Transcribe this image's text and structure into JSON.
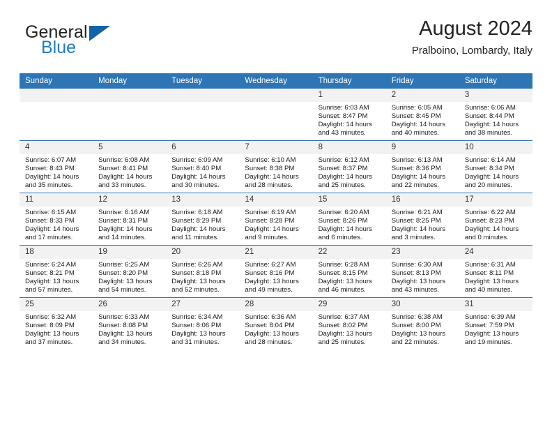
{
  "brand": {
    "word_one": "General",
    "word_two": "Blue",
    "logo_icon": "triangle-logo-icon",
    "accent_color": "#1463a8",
    "blue_text_color": "#1f7bc1"
  },
  "header": {
    "title": "August 2024",
    "subtitle": "Pralboino, Lombardy, Italy"
  },
  "theme": {
    "header_row_color": "#2e75b6",
    "daynum_band_color": "#f2f2f2",
    "text_color": "#1a1a1a"
  },
  "weekdays": [
    "Sunday",
    "Monday",
    "Tuesday",
    "Wednesday",
    "Thursday",
    "Friday",
    "Saturday"
  ],
  "weeks": [
    [
      {
        "day": "",
        "empty": true
      },
      {
        "day": "",
        "empty": true
      },
      {
        "day": "",
        "empty": true
      },
      {
        "day": "",
        "empty": true
      },
      {
        "day": "1",
        "sunrise": "Sunrise: 6:03 AM",
        "sunset": "Sunset: 8:47 PM",
        "daylight": "Daylight: 14 hours and 43 minutes."
      },
      {
        "day": "2",
        "sunrise": "Sunrise: 6:05 AM",
        "sunset": "Sunset: 8:45 PM",
        "daylight": "Daylight: 14 hours and 40 minutes."
      },
      {
        "day": "3",
        "sunrise": "Sunrise: 6:06 AM",
        "sunset": "Sunset: 8:44 PM",
        "daylight": "Daylight: 14 hours and 38 minutes."
      }
    ],
    [
      {
        "day": "4",
        "sunrise": "Sunrise: 6:07 AM",
        "sunset": "Sunset: 8:43 PM",
        "daylight": "Daylight: 14 hours and 35 minutes."
      },
      {
        "day": "5",
        "sunrise": "Sunrise: 6:08 AM",
        "sunset": "Sunset: 8:41 PM",
        "daylight": "Daylight: 14 hours and 33 minutes."
      },
      {
        "day": "6",
        "sunrise": "Sunrise: 6:09 AM",
        "sunset": "Sunset: 8:40 PM",
        "daylight": "Daylight: 14 hours and 30 minutes."
      },
      {
        "day": "7",
        "sunrise": "Sunrise: 6:10 AM",
        "sunset": "Sunset: 8:38 PM",
        "daylight": "Daylight: 14 hours and 28 minutes."
      },
      {
        "day": "8",
        "sunrise": "Sunrise: 6:12 AM",
        "sunset": "Sunset: 8:37 PM",
        "daylight": "Daylight: 14 hours and 25 minutes."
      },
      {
        "day": "9",
        "sunrise": "Sunrise: 6:13 AM",
        "sunset": "Sunset: 8:36 PM",
        "daylight": "Daylight: 14 hours and 22 minutes."
      },
      {
        "day": "10",
        "sunrise": "Sunrise: 6:14 AM",
        "sunset": "Sunset: 8:34 PM",
        "daylight": "Daylight: 14 hours and 20 minutes."
      }
    ],
    [
      {
        "day": "11",
        "sunrise": "Sunrise: 6:15 AM",
        "sunset": "Sunset: 8:33 PM",
        "daylight": "Daylight: 14 hours and 17 minutes."
      },
      {
        "day": "12",
        "sunrise": "Sunrise: 6:16 AM",
        "sunset": "Sunset: 8:31 PM",
        "daylight": "Daylight: 14 hours and 14 minutes."
      },
      {
        "day": "13",
        "sunrise": "Sunrise: 6:18 AM",
        "sunset": "Sunset: 8:29 PM",
        "daylight": "Daylight: 14 hours and 11 minutes."
      },
      {
        "day": "14",
        "sunrise": "Sunrise: 6:19 AM",
        "sunset": "Sunset: 8:28 PM",
        "daylight": "Daylight: 14 hours and 9 minutes."
      },
      {
        "day": "15",
        "sunrise": "Sunrise: 6:20 AM",
        "sunset": "Sunset: 8:26 PM",
        "daylight": "Daylight: 14 hours and 6 minutes."
      },
      {
        "day": "16",
        "sunrise": "Sunrise: 6:21 AM",
        "sunset": "Sunset: 8:25 PM",
        "daylight": "Daylight: 14 hours and 3 minutes."
      },
      {
        "day": "17",
        "sunrise": "Sunrise: 6:22 AM",
        "sunset": "Sunset: 8:23 PM",
        "daylight": "Daylight: 14 hours and 0 minutes."
      }
    ],
    [
      {
        "day": "18",
        "sunrise": "Sunrise: 6:24 AM",
        "sunset": "Sunset: 8:21 PM",
        "daylight": "Daylight: 13 hours and 57 minutes."
      },
      {
        "day": "19",
        "sunrise": "Sunrise: 6:25 AM",
        "sunset": "Sunset: 8:20 PM",
        "daylight": "Daylight: 13 hours and 54 minutes."
      },
      {
        "day": "20",
        "sunrise": "Sunrise: 6:26 AM",
        "sunset": "Sunset: 8:18 PM",
        "daylight": "Daylight: 13 hours and 52 minutes."
      },
      {
        "day": "21",
        "sunrise": "Sunrise: 6:27 AM",
        "sunset": "Sunset: 8:16 PM",
        "daylight": "Daylight: 13 hours and 49 minutes."
      },
      {
        "day": "22",
        "sunrise": "Sunrise: 6:28 AM",
        "sunset": "Sunset: 8:15 PM",
        "daylight": "Daylight: 13 hours and 46 minutes."
      },
      {
        "day": "23",
        "sunrise": "Sunrise: 6:30 AM",
        "sunset": "Sunset: 8:13 PM",
        "daylight": "Daylight: 13 hours and 43 minutes."
      },
      {
        "day": "24",
        "sunrise": "Sunrise: 6:31 AM",
        "sunset": "Sunset: 8:11 PM",
        "daylight": "Daylight: 13 hours and 40 minutes."
      }
    ],
    [
      {
        "day": "25",
        "sunrise": "Sunrise: 6:32 AM",
        "sunset": "Sunset: 8:09 PM",
        "daylight": "Daylight: 13 hours and 37 minutes."
      },
      {
        "day": "26",
        "sunrise": "Sunrise: 6:33 AM",
        "sunset": "Sunset: 8:08 PM",
        "daylight": "Daylight: 13 hours and 34 minutes."
      },
      {
        "day": "27",
        "sunrise": "Sunrise: 6:34 AM",
        "sunset": "Sunset: 8:06 PM",
        "daylight": "Daylight: 13 hours and 31 minutes."
      },
      {
        "day": "28",
        "sunrise": "Sunrise: 6:36 AM",
        "sunset": "Sunset: 8:04 PM",
        "daylight": "Daylight: 13 hours and 28 minutes."
      },
      {
        "day": "29",
        "sunrise": "Sunrise: 6:37 AM",
        "sunset": "Sunset: 8:02 PM",
        "daylight": "Daylight: 13 hours and 25 minutes."
      },
      {
        "day": "30",
        "sunrise": "Sunrise: 6:38 AM",
        "sunset": "Sunset: 8:00 PM",
        "daylight": "Daylight: 13 hours and 22 minutes."
      },
      {
        "day": "31",
        "sunrise": "Sunrise: 6:39 AM",
        "sunset": "Sunset: 7:59 PM",
        "daylight": "Daylight: 13 hours and 19 minutes."
      }
    ]
  ]
}
